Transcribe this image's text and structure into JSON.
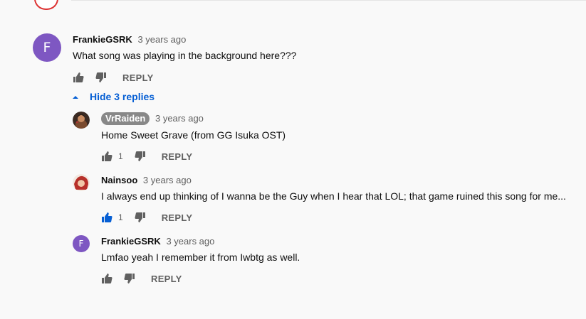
{
  "colors": {
    "avatar_purple": "#7e57c2",
    "link_blue": "#065fd4",
    "text_secondary": "#606060",
    "liked_blue": "#065fd4"
  },
  "comment": {
    "avatar_letter": "F",
    "author": "FrankieGSRK",
    "time": "3 years ago",
    "text": "What song was playing in the background here???",
    "reply_label": "REPLY"
  },
  "replies_toggle": {
    "label": "Hide 3 replies",
    "icon": "caret-up-icon"
  },
  "replies": [
    {
      "author": "VrRaiden",
      "time": "3 years ago",
      "text": "Home Sweet Grave (from GG Isuka OST)",
      "likes": "1",
      "reply_label": "REPLY",
      "liked": false
    },
    {
      "author": "Nainsoo",
      "time": "3 years ago",
      "text": "I always end up thinking of I wanna be the Guy when I hear that LOL; that game ruined this song for me...",
      "likes": "1",
      "reply_label": "REPLY",
      "liked": true
    },
    {
      "avatar_letter": "F",
      "author": "FrankieGSRK",
      "time": "3 years ago",
      "text": "Lmfao yeah I remember it from Iwbtg as well.",
      "reply_label": "REPLY",
      "liked": false
    }
  ]
}
